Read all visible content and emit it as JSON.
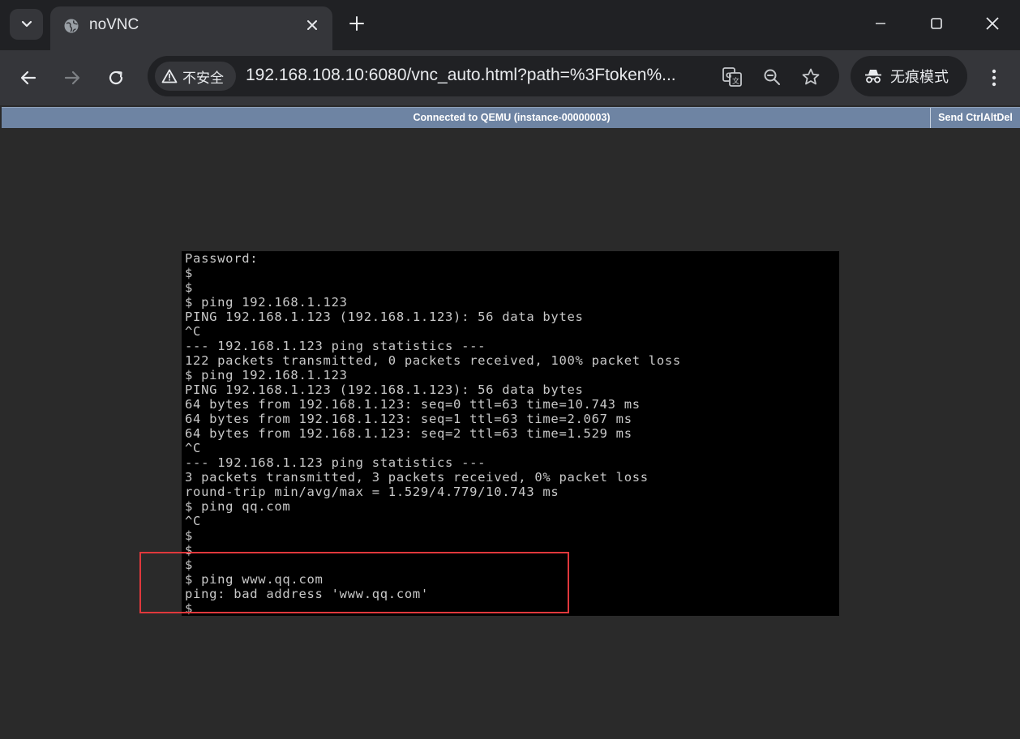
{
  "browser": {
    "tab": {
      "title": "noVNC",
      "icon": "globe-icon"
    },
    "security_label": "不安全",
    "url": "192.168.108.10:6080/vnc_auto.html?path=%3Ftoken%...",
    "incognito_label": "无痕模式"
  },
  "novnc": {
    "status": "Connected to QEMU (instance-00000003)",
    "send_ctrl_alt_del": "Send CtrlAltDel",
    "bar_color": "#6e84a3"
  },
  "console": {
    "lines": [
      "Password:",
      "$",
      "$",
      "$ ping 192.168.1.123",
      "PING 192.168.1.123 (192.168.1.123): 56 data bytes",
      "^C",
      "--- 192.168.1.123 ping statistics ---",
      "122 packets transmitted, 0 packets received, 100% packet loss",
      "$ ping 192.168.1.123",
      "PING 192.168.1.123 (192.168.1.123): 56 data bytes",
      "64 bytes from 192.168.1.123: seq=0 ttl=63 time=10.743 ms",
      "64 bytes from 192.168.1.123: seq=1 ttl=63 time=2.067 ms",
      "64 bytes from 192.168.1.123: seq=2 ttl=63 time=1.529 ms",
      "^C",
      "--- 192.168.1.123 ping statistics ---",
      "3 packets transmitted, 3 packets received, 0% packet loss",
      "round-trip min/avg/max = 1.529/4.779/10.743 ms",
      "$ ping qq.com",
      "^C",
      "$",
      "$",
      "$",
      "$ ping www.qq.com",
      "ping: bad address 'www.qq.com'",
      "$"
    ]
  },
  "annotation": {
    "color": "#e0383c"
  }
}
